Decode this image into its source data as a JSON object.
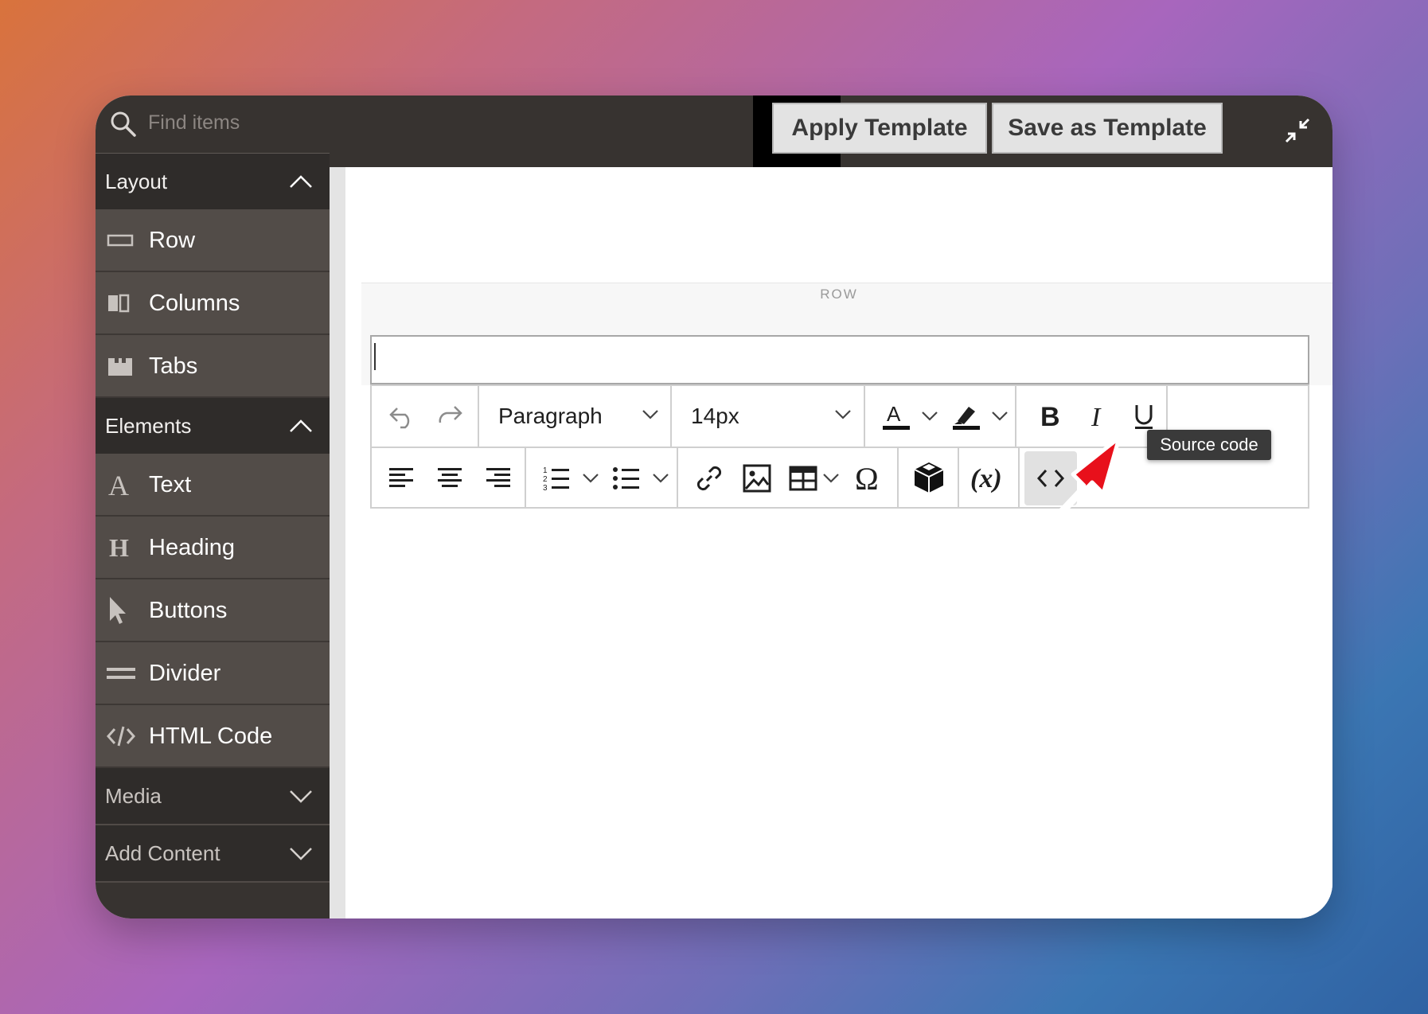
{
  "search": {
    "placeholder": "Find items"
  },
  "header": {
    "apply_template": "Apply Template",
    "save_template": "Save as Template"
  },
  "sidebar": {
    "layout": {
      "label": "Layout",
      "items": [
        {
          "label": "Row",
          "icon": "row-icon"
        },
        {
          "label": "Columns",
          "icon": "columns-icon"
        },
        {
          "label": "Tabs",
          "icon": "tabs-icon"
        }
      ]
    },
    "elements": {
      "label": "Elements",
      "items": [
        {
          "label": "Text",
          "icon": "text-icon"
        },
        {
          "label": "Heading",
          "icon": "heading-icon"
        },
        {
          "label": "Buttons",
          "icon": "cursor-icon"
        },
        {
          "label": "Divider",
          "icon": "divider-icon"
        },
        {
          "label": "HTML Code",
          "icon": "code-icon"
        }
      ]
    },
    "media": {
      "label": "Media"
    },
    "add_content": {
      "label": "Add Content"
    }
  },
  "stage": {
    "row_label": "ROW"
  },
  "toolbar": {
    "block_format": "Paragraph",
    "font_size": "14px"
  },
  "tooltip": {
    "text": "Source code"
  },
  "colors": {
    "arrow": "#e8101b",
    "sidebar_bg": "#373330",
    "item_bg": "#524c48"
  }
}
